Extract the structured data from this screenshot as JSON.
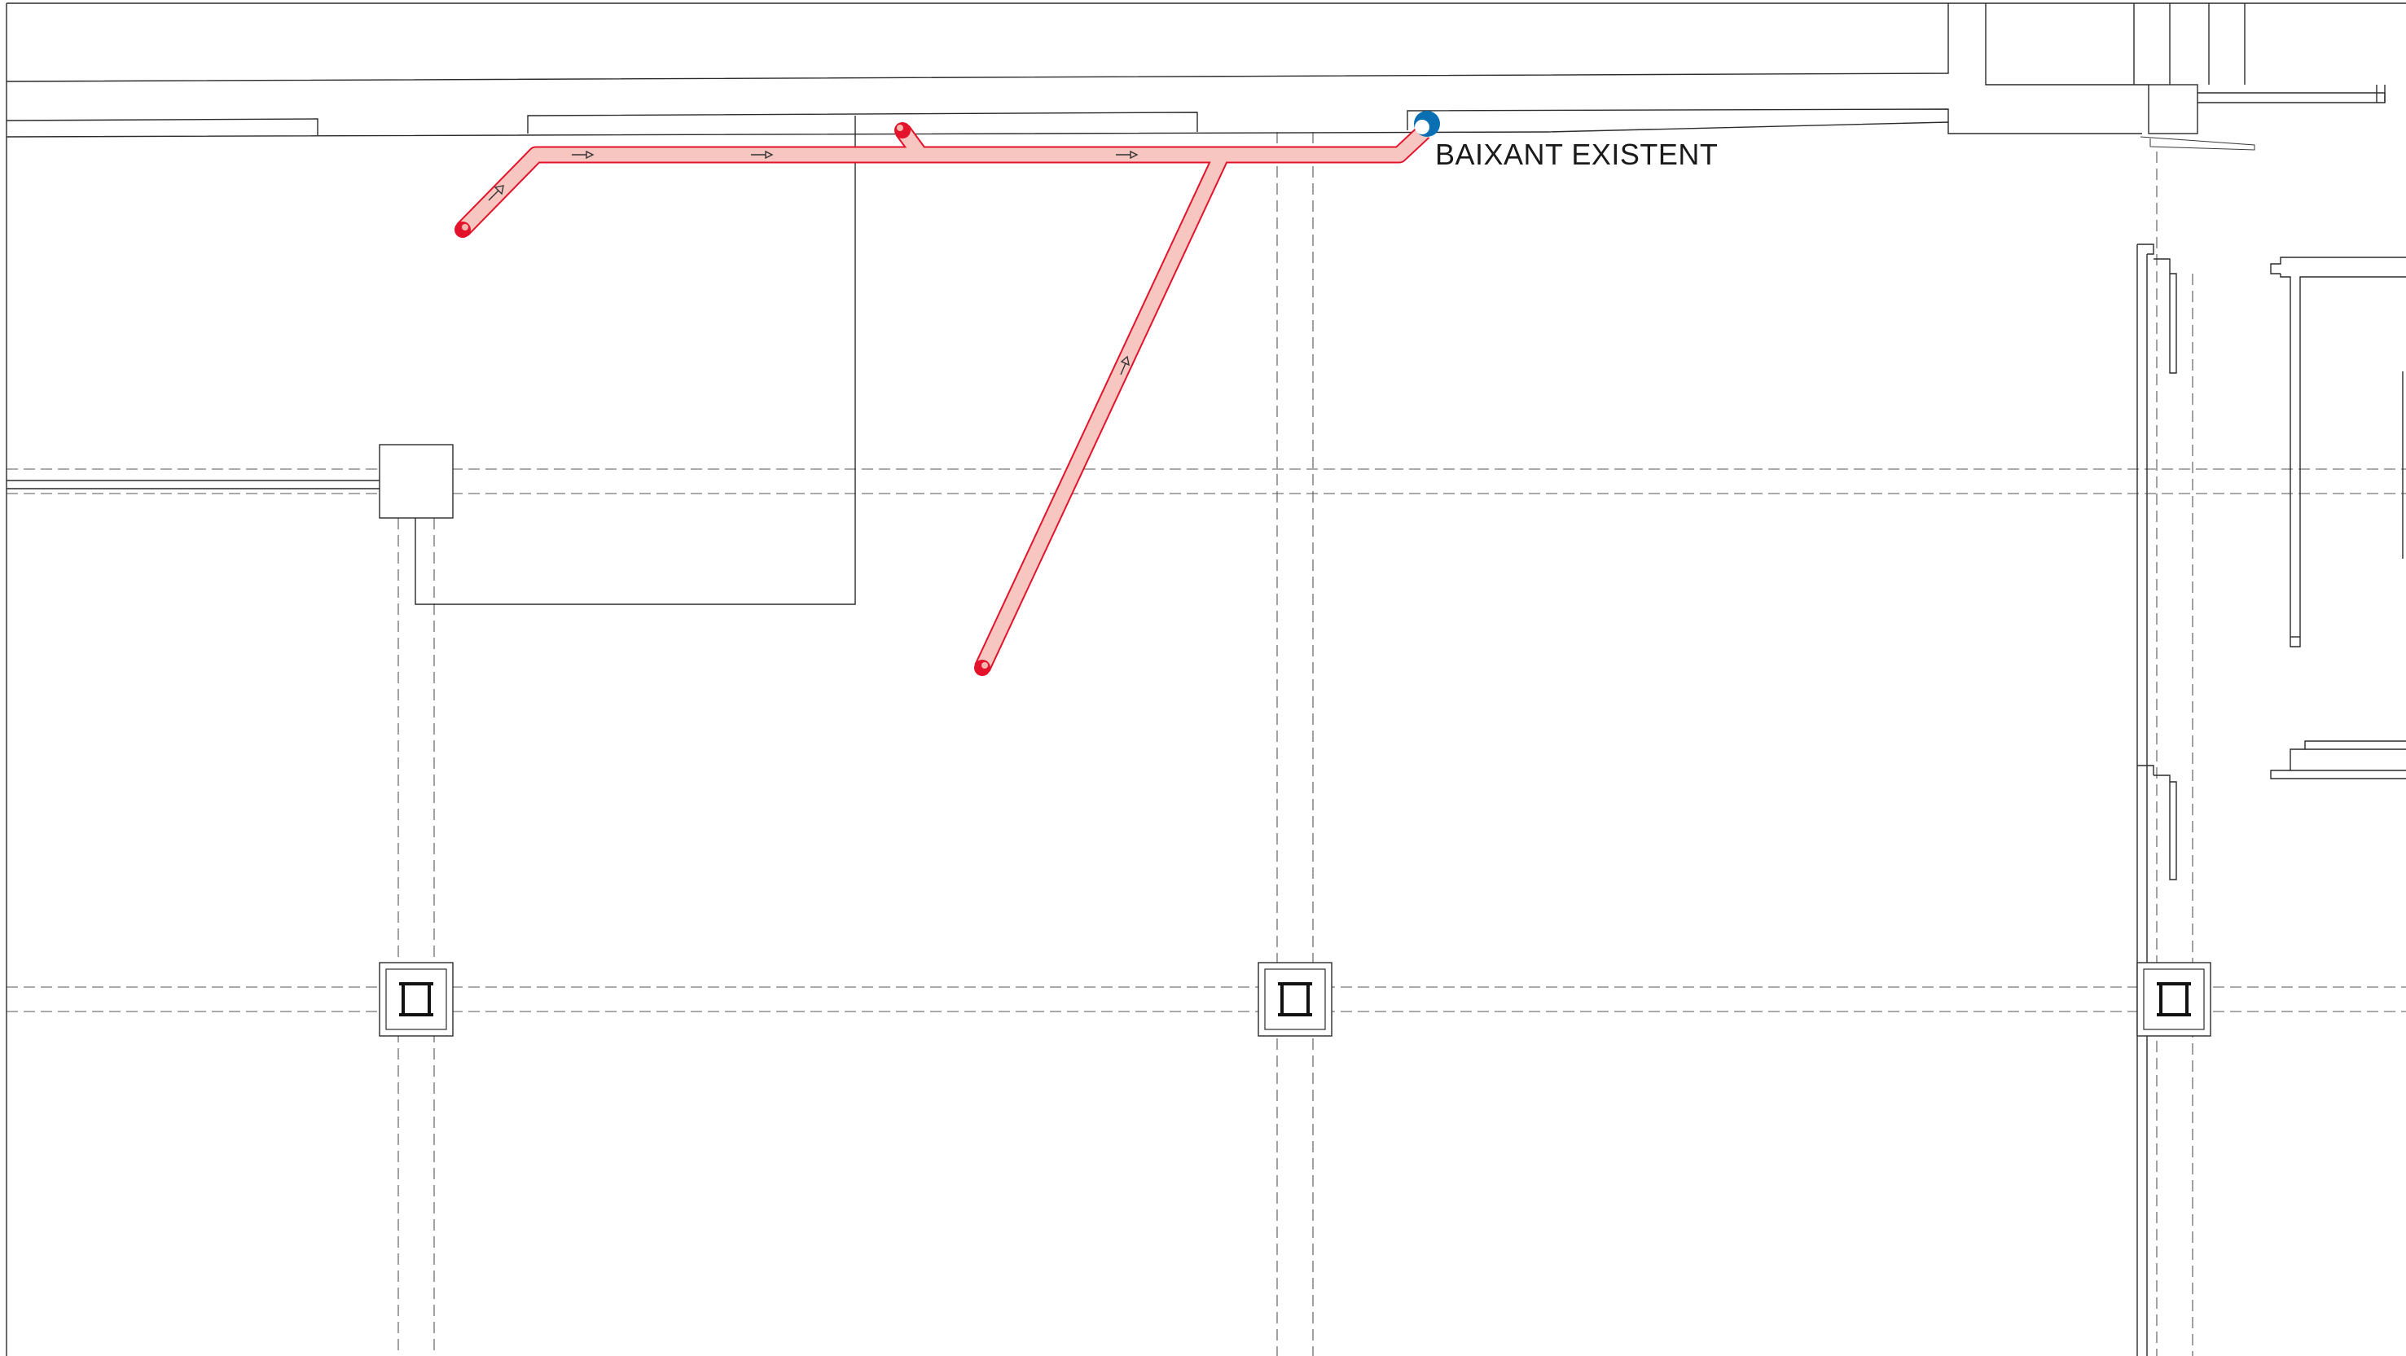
{
  "drawing": {
    "downpipe_label": "BAIXANT EXISTENT"
  },
  "colors": {
    "pipe_stroke": "#e3132b",
    "pipe_fill": "#f8c6c0",
    "downpipe": "#0a6fb3",
    "lines": "#2b2b2b"
  },
  "icons": {
    "column": "ibeam-column-symbol",
    "flow": "flow-direction-arrow",
    "downpipe": "existing-downpipe-marker"
  }
}
